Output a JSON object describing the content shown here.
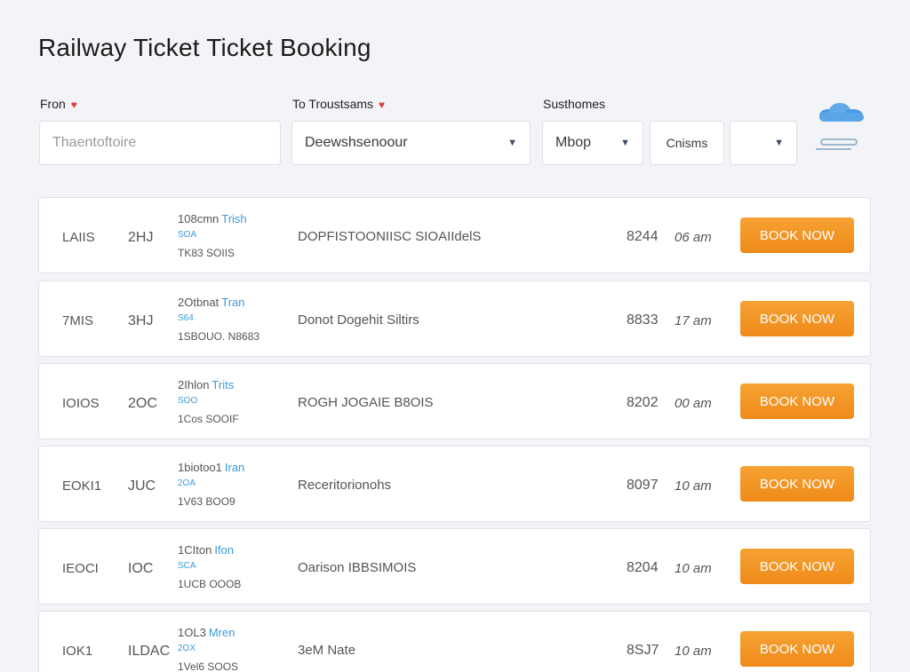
{
  "page": {
    "title": "Railway Ticket Ticket Booking"
  },
  "search": {
    "from_label": "Fron",
    "to_label": "To Troustsams",
    "class_label": "Susthomes",
    "from_placeholder": "Thaentoftoire",
    "to_value": "Deewshsenoour",
    "class_value": "Mbop",
    "date_value": "Cnisms",
    "extra_value": ""
  },
  "results": [
    {
      "code1": "LAIIS",
      "code2": "2HJ",
      "top": "108cmn",
      "tag": "Trish",
      "mid": "SOA",
      "bot": "TK83 SOIIS",
      "desc": "DOPFISTOONIISC SIOAIIdelS",
      "price": "8244",
      "time": "06 am",
      "book": "BOOK NOW"
    },
    {
      "code1": "7MIS",
      "code2": "3HJ",
      "top": "2Otbnat",
      "tag": "Tran",
      "mid": "S64",
      "bot": "1SBOUO. N8683",
      "desc": "Donot Dogehit Siltirs",
      "price": "8833",
      "time": "17 am",
      "book": "BOOK NOW"
    },
    {
      "code1": "IOIOS",
      "code2": "2OC",
      "top": "2Ihlon",
      "tag": "Trits",
      "mid": "SOO",
      "bot": "1Cos SOOIF",
      "desc": "ROGH JOGAIE B8OIS",
      "price": "8202",
      "time": "00 am",
      "book": "BOOK NOW"
    },
    {
      "code1": "EOKI1",
      "code2": "JUC",
      "top": "1biotoo1",
      "tag": "Iran",
      "mid": "2OA",
      "bot": "1V63 BOO9",
      "desc": "Receritorionohs",
      "price": "8097",
      "time": "10 am",
      "book": "BOOK NOW"
    },
    {
      "code1": "IEOCI",
      "code2": "IOC",
      "top": "1CIton",
      "tag": "Ifon",
      "mid": "SCA",
      "bot": "1UCB OOOB",
      "desc": "Oarison IBBSIMOIS",
      "price": "8204",
      "time": "10 am",
      "book": "BOOK NOW"
    },
    {
      "code1": "IOK1",
      "code2": "ILDAC",
      "top": "1OL3",
      "tag": "Mren",
      "mid": "2OX",
      "bot": "1Vel6 SOOS",
      "desc": "3eM Nate",
      "price": "8SJ7",
      "time": "10 am",
      "book": "BOOK NOW"
    }
  ],
  "colors": {
    "accent": "#f39425",
    "link": "#3a9ad9"
  }
}
